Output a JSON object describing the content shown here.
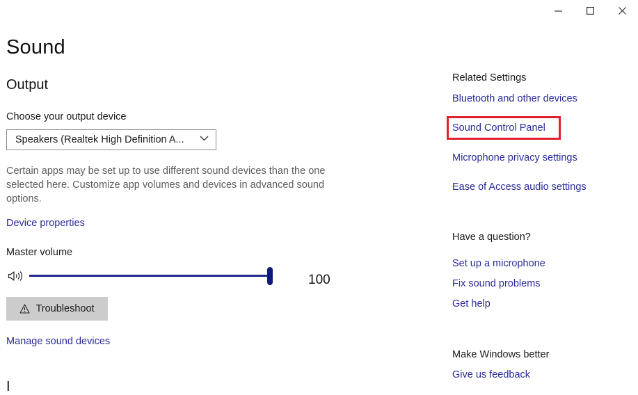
{
  "window": {
    "minimize_icon": "minimize-icon",
    "maximize_icon": "maximize-icon",
    "close_icon": "close-icon"
  },
  "page": {
    "title": "Sound"
  },
  "output": {
    "section_title": "Output",
    "choose_label": "Choose your output device",
    "device_selected": "Speakers (Realtek High Definition A...",
    "description": "Certain apps may be set up to use different sound devices than the one selected here. Customize app volumes and devices in advanced sound options.",
    "device_properties_link": "Device properties",
    "master_volume_label": "Master volume",
    "volume_value": "100",
    "volume_fraction": 1.0,
    "troubleshoot_label": "Troubleshoot",
    "manage_devices_link": "Manage sound devices",
    "next_section_partial": "I"
  },
  "related": {
    "heading": "Related Settings",
    "links": [
      "Bluetooth and other devices",
      "Sound Control Panel",
      "Microphone privacy settings",
      "Ease of Access audio settings"
    ]
  },
  "question": {
    "heading": "Have a question?",
    "links": [
      "Set up a microphone",
      "Fix sound problems",
      "Get help"
    ]
  },
  "feedback": {
    "heading": "Make Windows better",
    "link": "Give us feedback"
  },
  "colors": {
    "link": "#2b2b9b",
    "slider": "#1f2a88",
    "highlight": "#e0202a",
    "button_bg": "#cccccc"
  }
}
